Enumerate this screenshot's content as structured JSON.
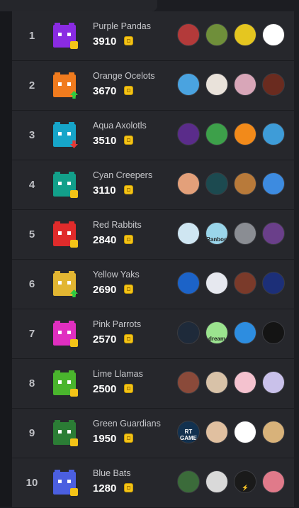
{
  "leaderboard": {
    "rows": [
      {
        "rank": "1",
        "team": "Purple Pandas",
        "score": "3910",
        "color": "#8a2be2",
        "badge": "eq",
        "avatars": [
          {
            "name": "red-hood-avatar",
            "bg": "#b33a3a"
          },
          {
            "name": "green-shirt-avatar",
            "bg": "#6f8f3a"
          },
          {
            "name": "sponge-avatar",
            "bg": "#e5c620"
          },
          {
            "name": "green-cube-avatar",
            "bg": "#ffffff"
          }
        ]
      },
      {
        "rank": "2",
        "team": "Orange Ocelots",
        "score": "3670",
        "color": "#f07b1e",
        "badge": "up",
        "avatars": [
          {
            "name": "rainbow-avatar",
            "bg": "#4aa3e0"
          },
          {
            "name": "white-hair-avatar",
            "bg": "#e9e2da"
          },
          {
            "name": "pink-avatar",
            "bg": "#d8a6b8"
          },
          {
            "name": "dark-brown-avatar",
            "bg": "#6a2b1f"
          }
        ]
      },
      {
        "rank": "3",
        "team": "Aqua Axolotls",
        "score": "3510",
        "color": "#16a5c9",
        "badge": "down",
        "avatars": [
          {
            "name": "purple-bot-avatar",
            "bg": "#5a2c8a"
          },
          {
            "name": "cat-avatar",
            "bg": "#3da04a"
          },
          {
            "name": "orange-fox-avatar",
            "bg": "#f28a1a"
          },
          {
            "name": "brown-hair-avatar",
            "bg": "#3e9cd8"
          }
        ]
      },
      {
        "rank": "4",
        "team": "Cyan Creepers",
        "score": "3110",
        "color": "#12a08a",
        "badge": "eq",
        "avatars": [
          {
            "name": "anime-avatar",
            "bg": "#e3a07a"
          },
          {
            "name": "teal-glow-avatar",
            "bg": "#1c4a50"
          },
          {
            "name": "creature-avatar",
            "bg": "#b87a3a"
          },
          {
            "name": "blue-sky-avatar",
            "bg": "#3d8be0"
          }
        ]
      },
      {
        "rank": "5",
        "team": "Red Rabbits",
        "score": "2840",
        "color": "#e02b2b",
        "badge": "eq",
        "avatars": [
          {
            "name": "blonde-avatar",
            "bg": "#cfe6f2"
          },
          {
            "name": "ranboo-avatar",
            "bg": "#9ad5ea",
            "text": "Ranboo"
          },
          {
            "name": "gray-face-avatar",
            "bg": "#8a8d93"
          },
          {
            "name": "purple-face-avatar",
            "bg": "#6a3f8a"
          }
        ]
      },
      {
        "rank": "6",
        "team": "Yellow Yaks",
        "score": "2690",
        "color": "#e2b632",
        "badge": "up",
        "avatars": [
          {
            "name": "s-logo-avatar",
            "bg": "#1c63c8"
          },
          {
            "name": "c-logo-avatar",
            "bg": "#e6e8ef"
          },
          {
            "name": "brown-cap-avatar",
            "bg": "#7a3a2a"
          },
          {
            "name": "red-mask-avatar",
            "bg": "#1c2f78"
          }
        ]
      },
      {
        "rank": "7",
        "team": "Pink Parrots",
        "score": "2570",
        "color": "#e02fc0",
        "badge": "eq",
        "avatars": [
          {
            "name": "red-eyes-avatar",
            "bg": "#1e2a3a"
          },
          {
            "name": "dream-avatar",
            "bg": "#9be38f",
            "text": "dream"
          },
          {
            "name": "blue-creature-avatar",
            "bg": "#2d8de0"
          },
          {
            "name": "black-mask-avatar",
            "bg": "#141414"
          }
        ]
      },
      {
        "rank": "8",
        "team": "Lime Llamas",
        "score": "2500",
        "color": "#4ab52d",
        "badge": "eq",
        "avatars": [
          {
            "name": "smile-avatar",
            "bg": "#8a4a3a"
          },
          {
            "name": "man-avatar",
            "bg": "#d8c2a8"
          },
          {
            "name": "pink-bunny-avatar",
            "bg": "#f4c2cf"
          },
          {
            "name": "glasses-avatar",
            "bg": "#c9c1ea"
          }
        ]
      },
      {
        "rank": "9",
        "team": "Green Guardians",
        "score": "1950",
        "color": "#2b7d35",
        "badge": "eq",
        "avatars": [
          {
            "name": "rt-game-avatar",
            "bg": "#12314f",
            "text": "RT GAME"
          },
          {
            "name": "beard-avatar",
            "bg": "#e0c0a0"
          },
          {
            "name": "red-drop-avatar",
            "bg": "#ffffff"
          },
          {
            "name": "doge-avatar",
            "bg": "#d8b27a"
          }
        ]
      },
      {
        "rank": "10",
        "team": "Blue Bats",
        "score": "1280",
        "color": "#4b5fe0",
        "badge": "eq",
        "avatars": [
          {
            "name": "green-tint-avatar",
            "bg": "#3b6b3a"
          },
          {
            "name": "bw-face-avatar",
            "bg": "#d9d9d9"
          },
          {
            "name": "lightning-avatar",
            "bg": "#1a1a1a",
            "text": "⚡"
          },
          {
            "name": "red-hair-avatar",
            "bg": "#e07a8a"
          }
        ]
      }
    ]
  }
}
